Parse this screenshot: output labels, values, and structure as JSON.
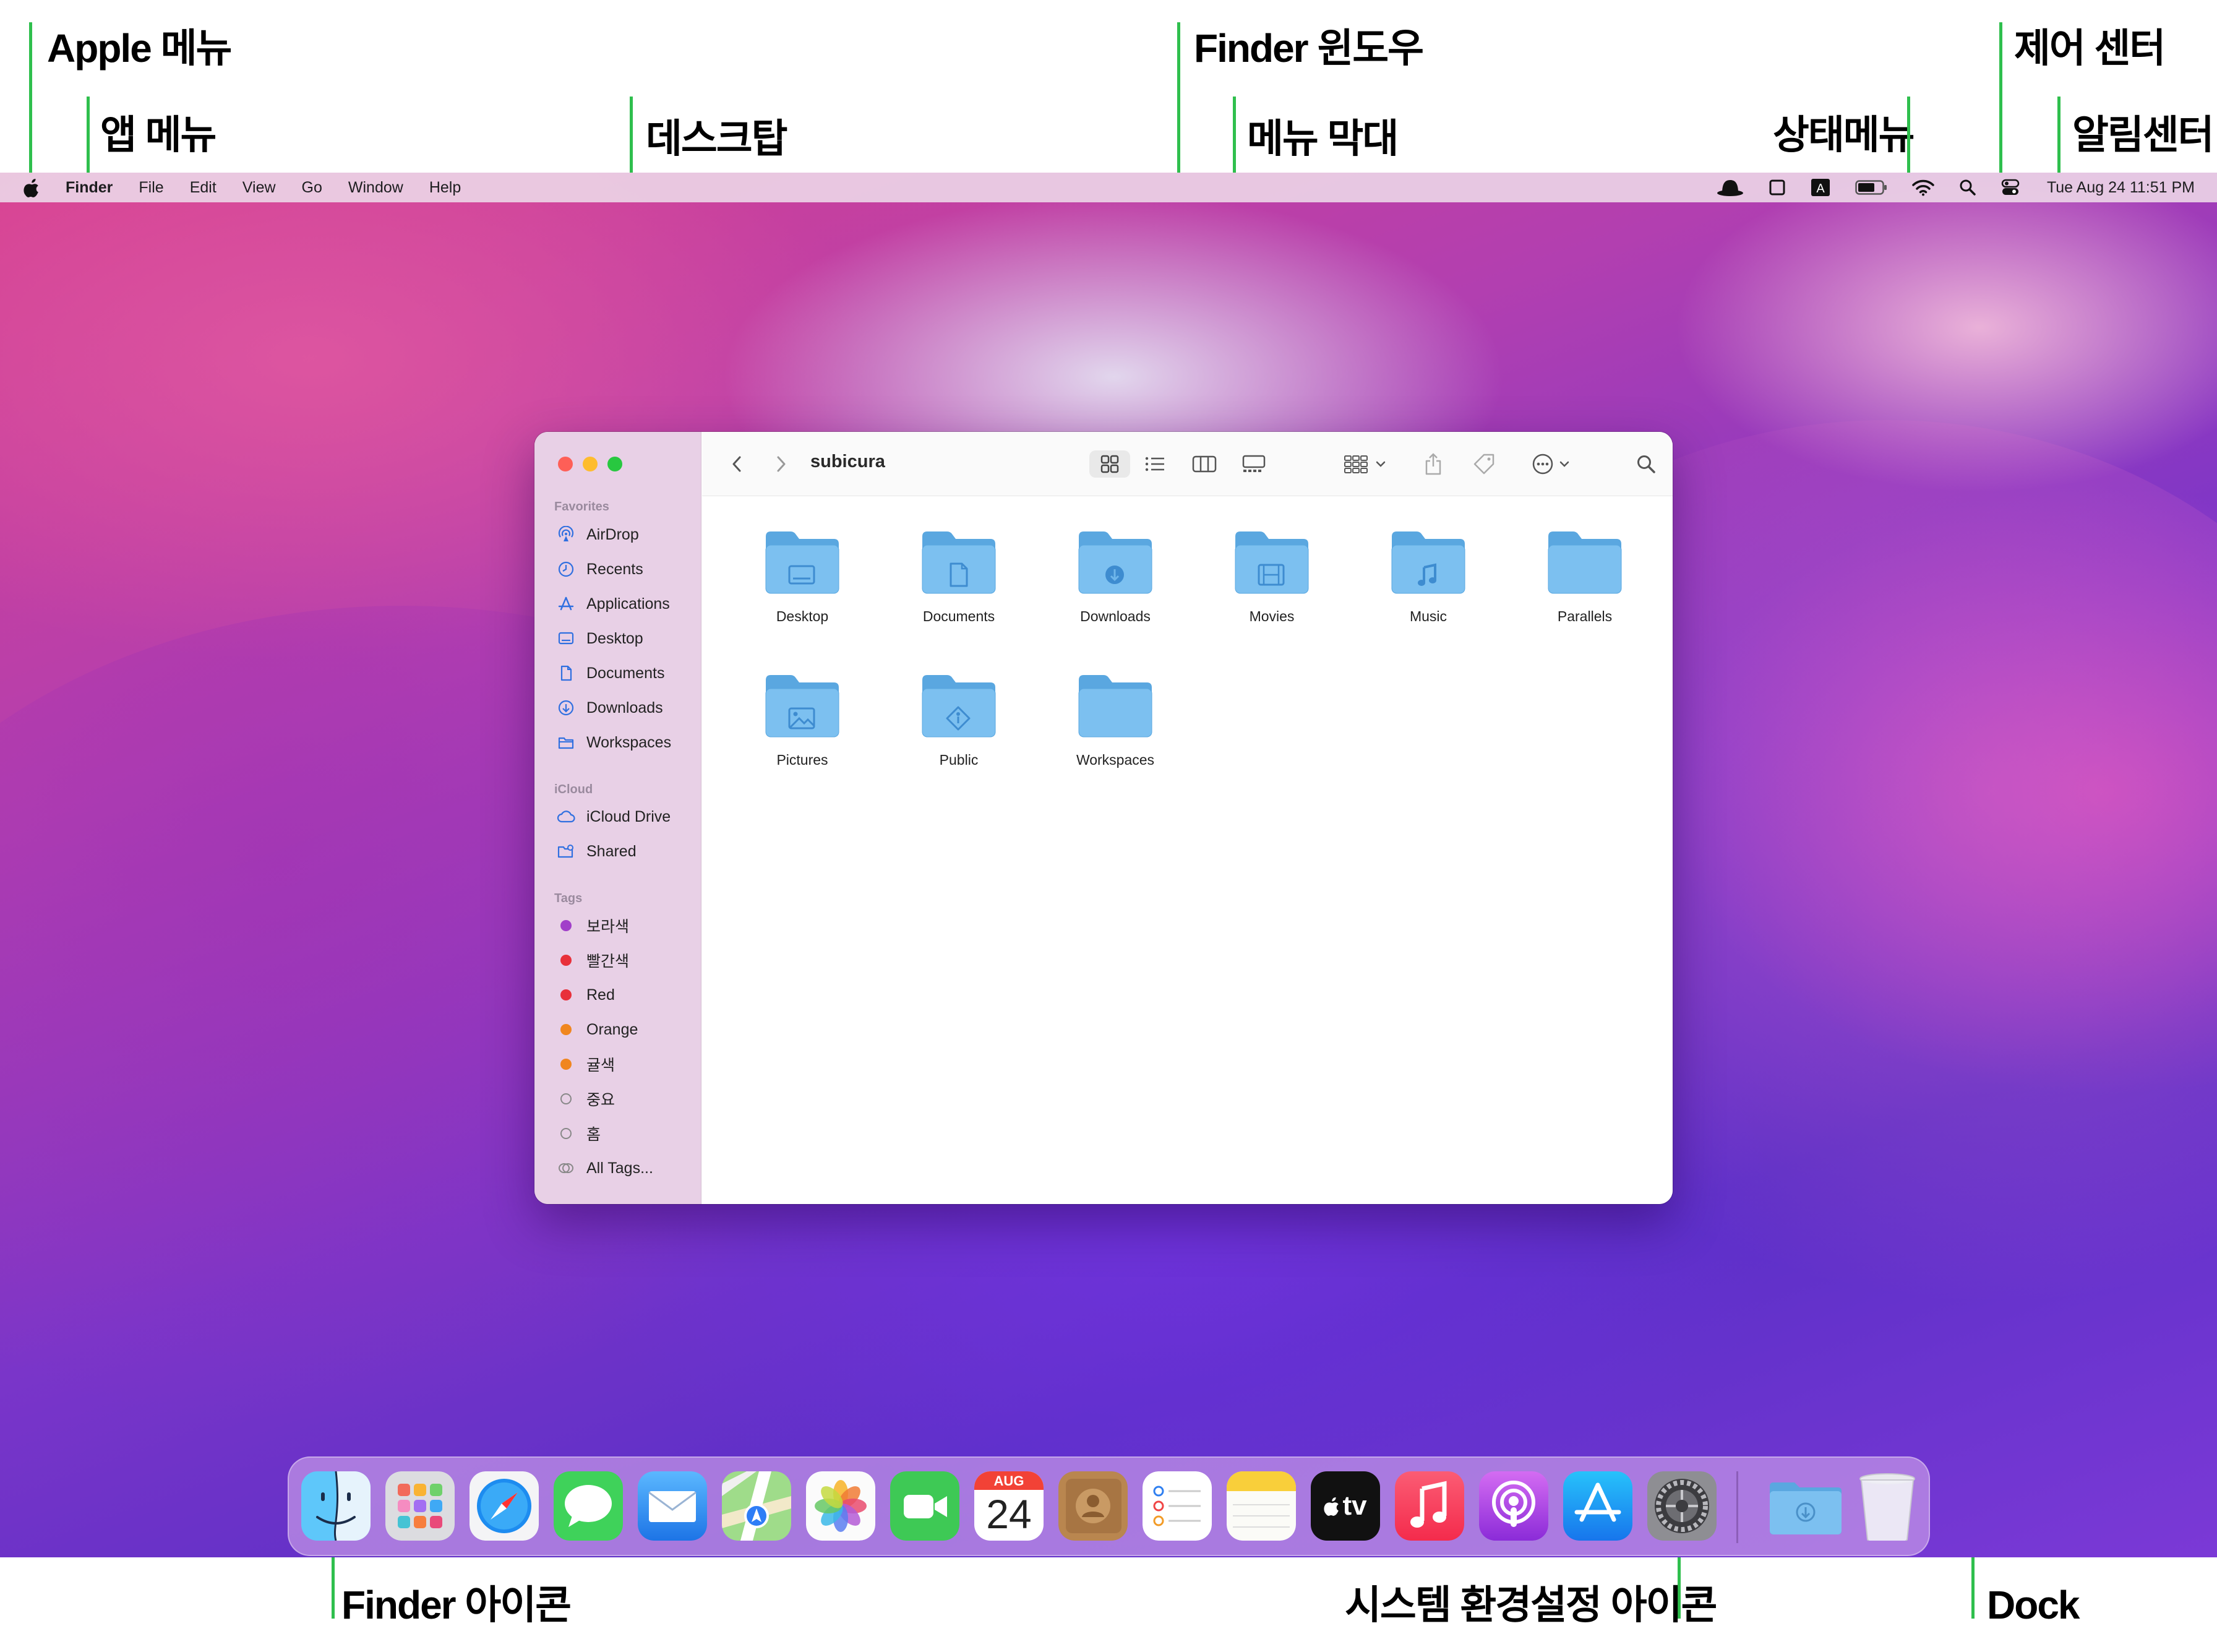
{
  "callouts": {
    "apple_menu": "Apple 메뉴",
    "app_menu": "앱 메뉴",
    "desktop": "데스크탑",
    "finder_window": "Finder 윈도우",
    "menu_bar": "메뉴 막대",
    "status_menu": "상태메뉴",
    "control_center": "제어 센터",
    "notification_center": "알림센터",
    "finder_icon": "Finder 아이콘",
    "system_prefs_icon": "시스템 환경설정 아이콘",
    "dock": "Dock"
  },
  "menubar": {
    "app_name": "Finder",
    "menus": [
      "File",
      "Edit",
      "View",
      "Go",
      "Window",
      "Help"
    ],
    "clock": "Tue Aug 24  11:51 PM"
  },
  "finder": {
    "path_title": "subicura",
    "sidebar": {
      "favorites_header": "Favorites",
      "favorites": [
        {
          "label": "AirDrop",
          "icon": "airdrop-icon"
        },
        {
          "label": "Recents",
          "icon": "clock-icon"
        },
        {
          "label": "Applications",
          "icon": "applications-icon"
        },
        {
          "label": "Desktop",
          "icon": "desktop-icon"
        },
        {
          "label": "Documents",
          "icon": "document-icon"
        },
        {
          "label": "Downloads",
          "icon": "download-icon"
        },
        {
          "label": "Workspaces",
          "icon": "folder-icon"
        }
      ],
      "icloud_header": "iCloud",
      "icloud": [
        {
          "label": "iCloud Drive",
          "icon": "cloud-icon"
        },
        {
          "label": "Shared",
          "icon": "shared-folder-icon"
        }
      ],
      "tags_header": "Tags",
      "tags": [
        {
          "label": "보라색",
          "color": "#a13fc9"
        },
        {
          "label": "빨간색",
          "color": "#e8303a"
        },
        {
          "label": "Red",
          "color": "#e8303a"
        },
        {
          "label": "Orange",
          "color": "#f0861f"
        },
        {
          "label": "귤색",
          "color": "#f0861f"
        },
        {
          "label": "중요",
          "color": ""
        },
        {
          "label": "홈",
          "color": ""
        },
        {
          "label": "All Tags...",
          "color": ""
        }
      ]
    },
    "folders": [
      {
        "label": "Desktop",
        "glyph": "desktop"
      },
      {
        "label": "Documents",
        "glyph": "document"
      },
      {
        "label": "Downloads",
        "glyph": "download"
      },
      {
        "label": "Movies",
        "glyph": "film"
      },
      {
        "label": "Music",
        "glyph": "music"
      },
      {
        "label": "Parallels",
        "glyph": "none"
      },
      {
        "label": "Pictures",
        "glyph": "picture"
      },
      {
        "label": "Public",
        "glyph": "public"
      },
      {
        "label": "Workspaces",
        "glyph": "none"
      }
    ]
  },
  "dock": {
    "calendar_month": "AUG",
    "calendar_day": "24",
    "tv_label": "tv",
    "apps": [
      "finder",
      "launchpad",
      "safari",
      "messages",
      "mail",
      "maps",
      "photos",
      "facetime",
      "calendar",
      "contacts",
      "reminders",
      "notes",
      "apple-tv",
      "music",
      "podcasts",
      "app-store",
      "system-preferences",
      "downloads-folder",
      "trash"
    ]
  },
  "colors": {
    "callout_line": "#2fbf4d",
    "folder_blue": "#6fb6ea",
    "traffic_red": "#fe5f57",
    "traffic_yellow": "#febc2e",
    "traffic_green": "#28c840"
  }
}
